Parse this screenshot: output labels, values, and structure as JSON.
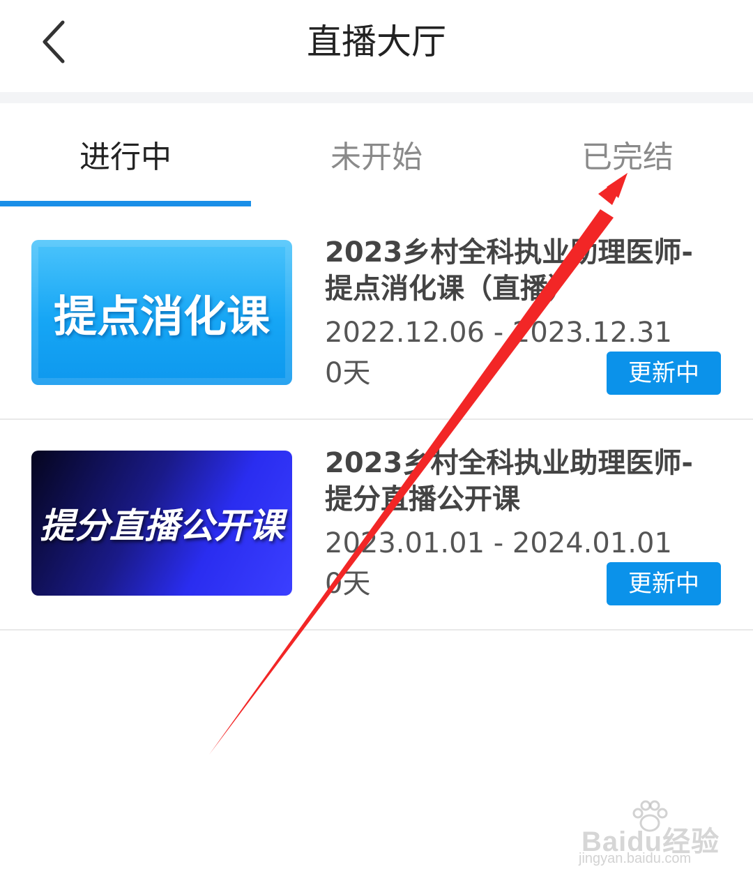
{
  "header": {
    "title": "直播大厅",
    "back_icon": "chevron-left-icon"
  },
  "tabs": [
    {
      "label": "进行中",
      "active": true
    },
    {
      "label": "未开始",
      "active": false
    },
    {
      "label": "已完结",
      "active": false
    }
  ],
  "accent_color": "#1a8fe8",
  "courses": [
    {
      "thumb_text": "提点消化课",
      "title": "2023乡村全科执业助理医师-提点消化课（直播）",
      "dates": "2022.12.06 - 2023.12.31",
      "days": "0天",
      "status": "更新中"
    },
    {
      "thumb_text": "提分直播公开课",
      "title": "2023乡村全科执业助理医师-提分直播公开课",
      "dates": "2023.01.01 - 2024.01.01",
      "days": "0天",
      "status": "更新中"
    }
  ],
  "watermark": {
    "brand": "Baidu经验",
    "url": "jingyan.baidu.com"
  }
}
